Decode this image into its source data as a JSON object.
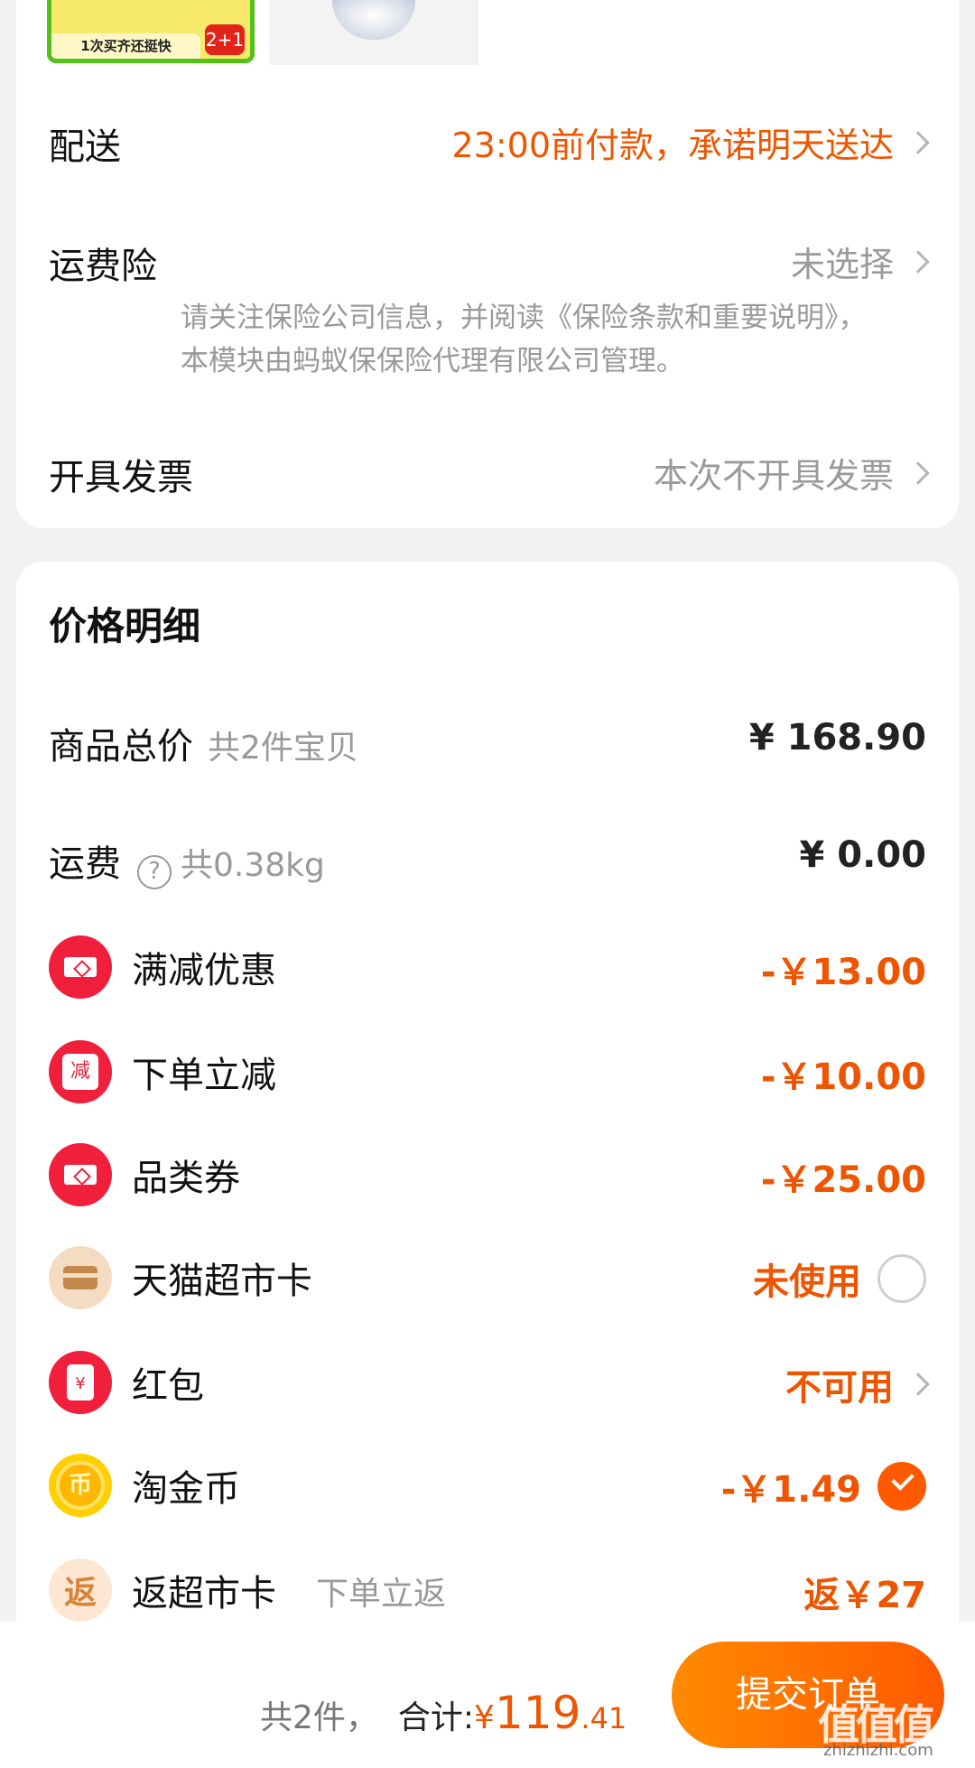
{
  "product_thumbs": {
    "thumb1_strip_text": "1次买齐还挺快",
    "thumb1_badge": "2+1"
  },
  "delivery": {
    "label": "配送",
    "value": "23:00前付款，承诺明天送达"
  },
  "shipping_insurance": {
    "label": "运费险",
    "value": "未选择",
    "note": "请关注保险公司信息，并阅读《保险条款和重要说明》，本模块由蚂蚁保保险代理有限公司管理。"
  },
  "invoice": {
    "label": "开具发票",
    "value": "本次不开具发票"
  },
  "price_detail": {
    "title": "价格明细",
    "goods_total": {
      "label": "商品总价",
      "sub": "共2件宝贝",
      "amount": "¥ 168.90"
    },
    "freight": {
      "label": "运费",
      "help_icon": "?",
      "sub": "共0.38kg",
      "amount": "¥ 0.00"
    },
    "items": [
      {
        "label": "满减优惠",
        "icon": "ticket-icon",
        "value": "-￥13.00"
      },
      {
        "label": "下单立减",
        "icon": "discount-icon",
        "icon_text": "减",
        "value": "-￥10.00"
      },
      {
        "label": "品类券",
        "icon": "ticket-icon",
        "value": "-￥25.00"
      },
      {
        "label": "天猫超市卡",
        "icon": "card-icon",
        "value": "未使用"
      },
      {
        "label": "红包",
        "icon": "red-envelope-icon",
        "icon_text": "¥",
        "value": "不可用"
      },
      {
        "label": "淘金币",
        "icon": "coin-icon",
        "icon_text": "币",
        "value": "-￥1.49"
      },
      {
        "label": "返超市卡",
        "icon": "rebate-icon",
        "icon_text": "返",
        "sub": "下单立返",
        "value": "返￥27"
      }
    ]
  },
  "bottom_bar": {
    "count": "共2件，",
    "total_label": "合计:",
    "yen": "¥",
    "total_int": "119",
    "total_dec": ".41",
    "submit": "提交订单"
  },
  "watermark": {
    "mark": "值值值",
    "text": "zhizhizhi.com"
  },
  "colors": {
    "accent": "#ee5500",
    "button": "#ff5a00",
    "bg": "#f2f2f2"
  }
}
